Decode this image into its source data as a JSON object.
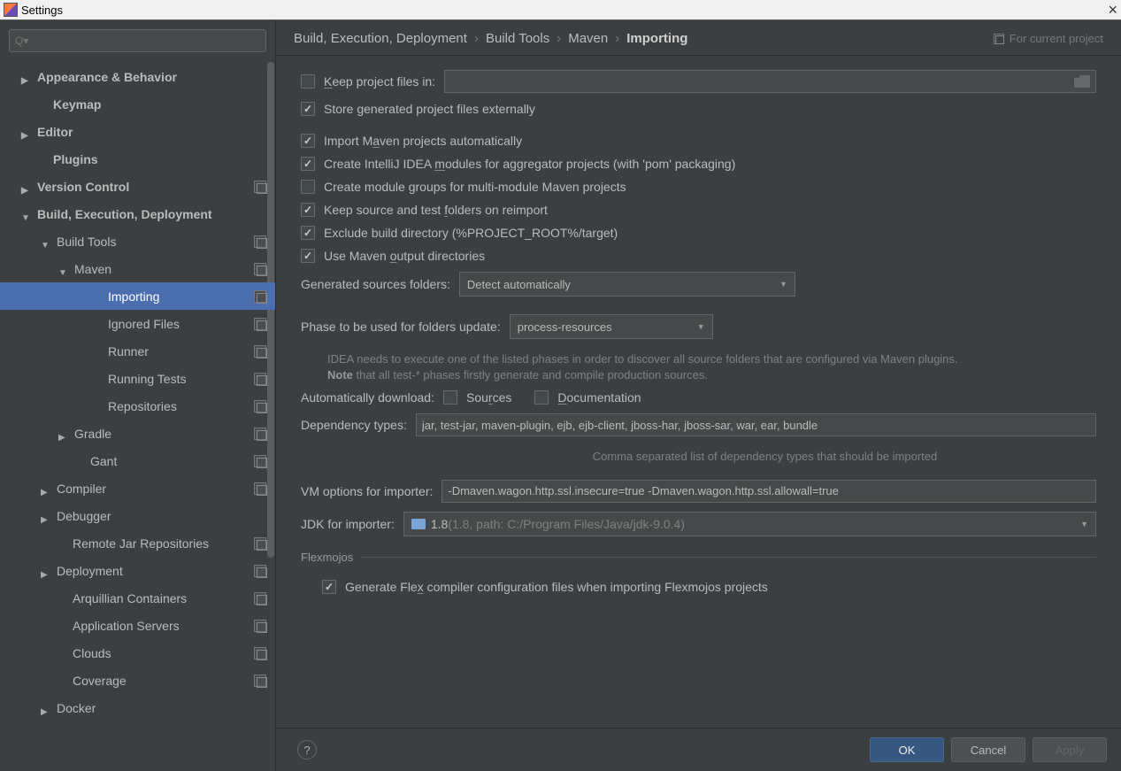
{
  "window": {
    "title": "Settings"
  },
  "search": {
    "placeholder": "Q▾"
  },
  "tree": {
    "items": [
      {
        "label": "Appearance & Behavior",
        "indent": 24,
        "arrow": "right",
        "bold": true
      },
      {
        "label": "Keymap",
        "indent": 42,
        "arrow": "none",
        "bold": true
      },
      {
        "label": "Editor",
        "indent": 24,
        "arrow": "right",
        "bold": true
      },
      {
        "label": "Plugins",
        "indent": 42,
        "arrow": "none",
        "bold": true
      },
      {
        "label": "Version Control",
        "indent": 24,
        "arrow": "right",
        "bold": true,
        "copy": true
      },
      {
        "label": "Build, Execution, Deployment",
        "indent": 24,
        "arrow": "down",
        "bold": true
      },
      {
        "label": "Build Tools",
        "indent": 46,
        "arrow": "down",
        "copy": true
      },
      {
        "label": "Maven",
        "indent": 66,
        "arrow": "down",
        "copy": true
      },
      {
        "label": "Importing",
        "indent": 104,
        "arrow": "none",
        "selected": true,
        "copy": true
      },
      {
        "label": "Ignored Files",
        "indent": 104,
        "arrow": "none",
        "copy": true
      },
      {
        "label": "Runner",
        "indent": 104,
        "arrow": "none",
        "copy": true
      },
      {
        "label": "Running Tests",
        "indent": 104,
        "arrow": "none",
        "copy": true
      },
      {
        "label": "Repositories",
        "indent": 104,
        "arrow": "none",
        "copy": true
      },
      {
        "label": "Gradle",
        "indent": 66,
        "arrow": "right",
        "copy": true
      },
      {
        "label": "Gant",
        "indent": 84,
        "arrow": "none",
        "copy": true
      },
      {
        "label": "Compiler",
        "indent": 46,
        "arrow": "right",
        "copy": true
      },
      {
        "label": "Debugger",
        "indent": 46,
        "arrow": "right"
      },
      {
        "label": "Remote Jar Repositories",
        "indent": 64,
        "arrow": "none",
        "copy": true
      },
      {
        "label": "Deployment",
        "indent": 46,
        "arrow": "right",
        "copy": true
      },
      {
        "label": "Arquillian Containers",
        "indent": 64,
        "arrow": "none",
        "copy": true
      },
      {
        "label": "Application Servers",
        "indent": 64,
        "arrow": "none",
        "copy": true
      },
      {
        "label": "Clouds",
        "indent": 64,
        "arrow": "none",
        "copy": true
      },
      {
        "label": "Coverage",
        "indent": 64,
        "arrow": "none",
        "copy": true
      },
      {
        "label": "Docker",
        "indent": 46,
        "arrow": "right"
      }
    ]
  },
  "breadcrumb": {
    "parts": [
      "Build, Execution, Deployment",
      "Build Tools",
      "Maven",
      "Importing"
    ],
    "scope": "For current project"
  },
  "form": {
    "keep_files_label": "Keep project files in:",
    "keep_files_checked": false,
    "keep_files_value": "",
    "store_externally": {
      "label": "Store generated project files externally",
      "checked": true
    },
    "import_auto": {
      "label": "Import Maven projects automatically",
      "checked": true
    },
    "create_modules": {
      "label": "Create IntelliJ IDEA modules for aggregator projects (with 'pom' packaging)",
      "checked": true
    },
    "create_module_groups": {
      "label": "Create module groups for multi-module Maven projects",
      "checked": false
    },
    "keep_folders": {
      "label": "Keep source and test folders on reimport",
      "checked": true
    },
    "exclude_build": {
      "label": "Exclude build directory (%PROJECT_ROOT%/target)",
      "checked": true
    },
    "use_output": {
      "label": "Use Maven output directories",
      "checked": true
    },
    "generated_label": "Generated sources folders:",
    "generated_value": "Detect automatically",
    "phase_label": "Phase to be used for folders update:",
    "phase_value": "process-resources",
    "phase_hint_a": "IDEA needs to execute one of the listed phases in order to discover all source folders that are configured via Maven plugins.",
    "phase_hint_b": "Note",
    "phase_hint_c": " that all test-* phases firstly generate and compile production sources.",
    "auto_dl_label": "Automatically download:",
    "sources": {
      "label": "Sources",
      "checked": false
    },
    "docs": {
      "label": "Documentation",
      "checked": false
    },
    "dep_types_label": "Dependency types:",
    "dep_types_value": "jar, test-jar, maven-plugin, ejb, ejb-client, jboss-har, jboss-sar, war, ear, bundle",
    "dep_types_hint": "Comma separated list of dependency types that should be imported",
    "vm_label": "VM options for importer:",
    "vm_value": "-Dmaven.wagon.http.ssl.insecure=true -Dmaven.wagon.http.ssl.allowall=true",
    "jdk_label": "JDK for importer:",
    "jdk_value": "1.8",
    "jdk_path": " (1.8, path: C:/Program Files/Java/jdk-9.0.4)",
    "flexmojos_title": "Flexmojos",
    "flexmojos": {
      "label": "Generate Flex compiler configuration files when importing Flexmojos projects",
      "checked": true
    }
  },
  "buttons": {
    "ok": "OK",
    "cancel": "Cancel",
    "apply": "Apply"
  }
}
